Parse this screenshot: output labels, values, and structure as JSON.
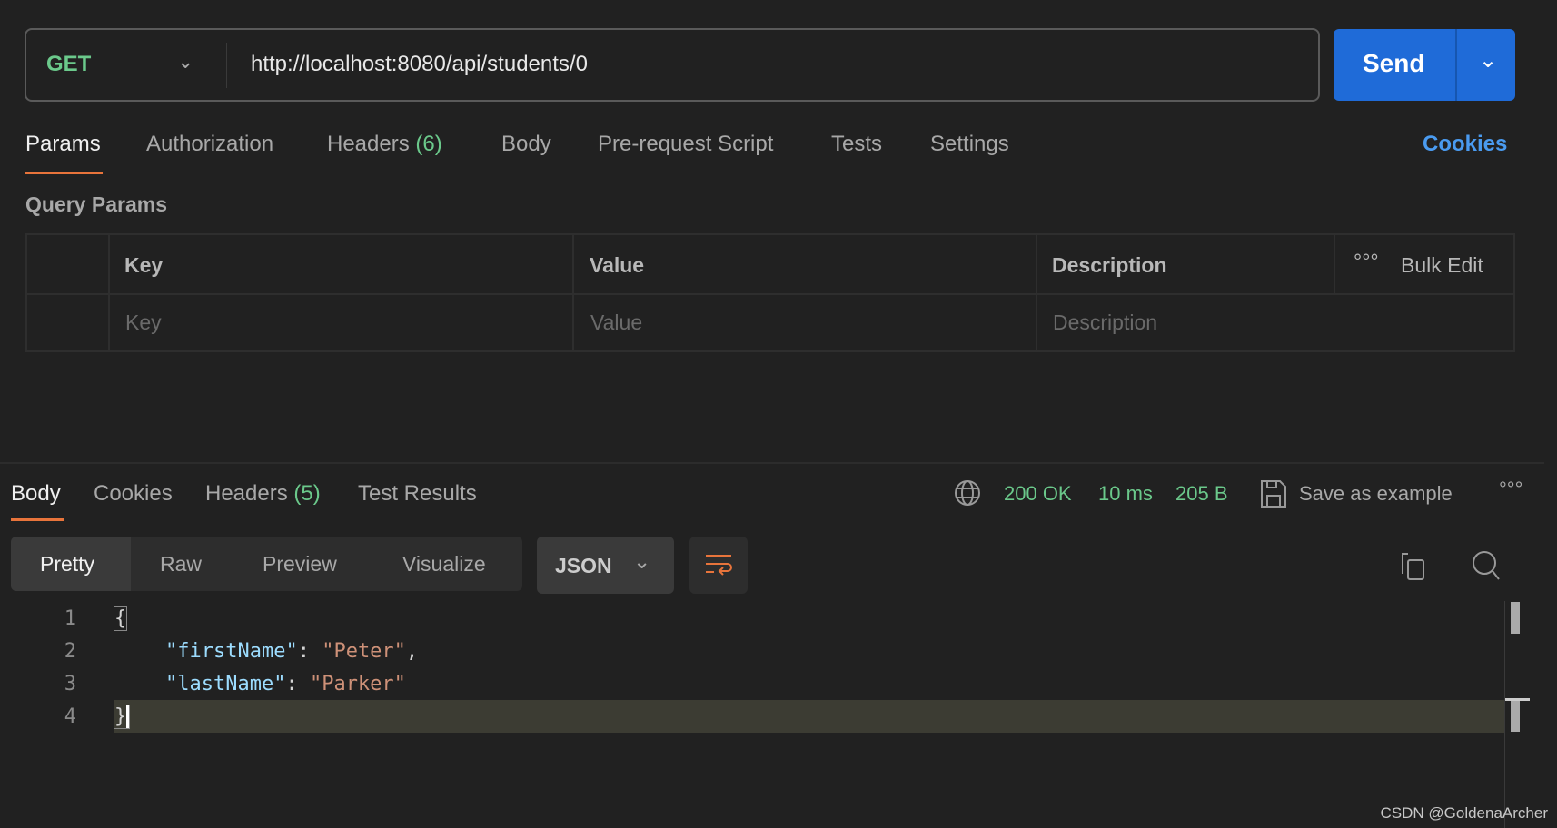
{
  "request": {
    "method": "GET",
    "url": "http://localhost:8080/api/students/0",
    "send_label": "Send"
  },
  "tabs": [
    {
      "label": "Params"
    },
    {
      "label": "Authorization"
    },
    {
      "label": "Headers",
      "count": "(6)"
    },
    {
      "label": "Body"
    },
    {
      "label": "Pre-request Script"
    },
    {
      "label": "Tests"
    },
    {
      "label": "Settings"
    }
  ],
  "cookies_link": "Cookies",
  "query_params": {
    "title": "Query Params",
    "headers": [
      "Key",
      "Value",
      "Description"
    ],
    "bulk_edit": "Bulk Edit",
    "placeholders": [
      "Key",
      "Value",
      "Description"
    ]
  },
  "response": {
    "tabs": [
      {
        "label": "Body"
      },
      {
        "label": "Cookies"
      },
      {
        "label": "Headers",
        "count": "(5)"
      },
      {
        "label": "Test Results"
      }
    ],
    "status": "200 OK",
    "time": "10 ms",
    "size": "205 B",
    "save_example": "Save as example",
    "views": [
      "Pretty",
      "Raw",
      "Preview",
      "Visualize"
    ],
    "format": "JSON",
    "lines": [
      "1",
      "2",
      "3",
      "4"
    ],
    "code": {
      "open": "{",
      "k1": "\"firstName\"",
      "v1": "\"Peter\"",
      "k2": "\"lastName\"",
      "v2": "\"Parker\"",
      "close": "}"
    }
  },
  "watermark": "CSDN @GoldenaArcher",
  "colors": {
    "accent": "#e8743b",
    "send": "#1f6bd8",
    "success": "#6bc98b",
    "link": "#4a9bf0"
  }
}
